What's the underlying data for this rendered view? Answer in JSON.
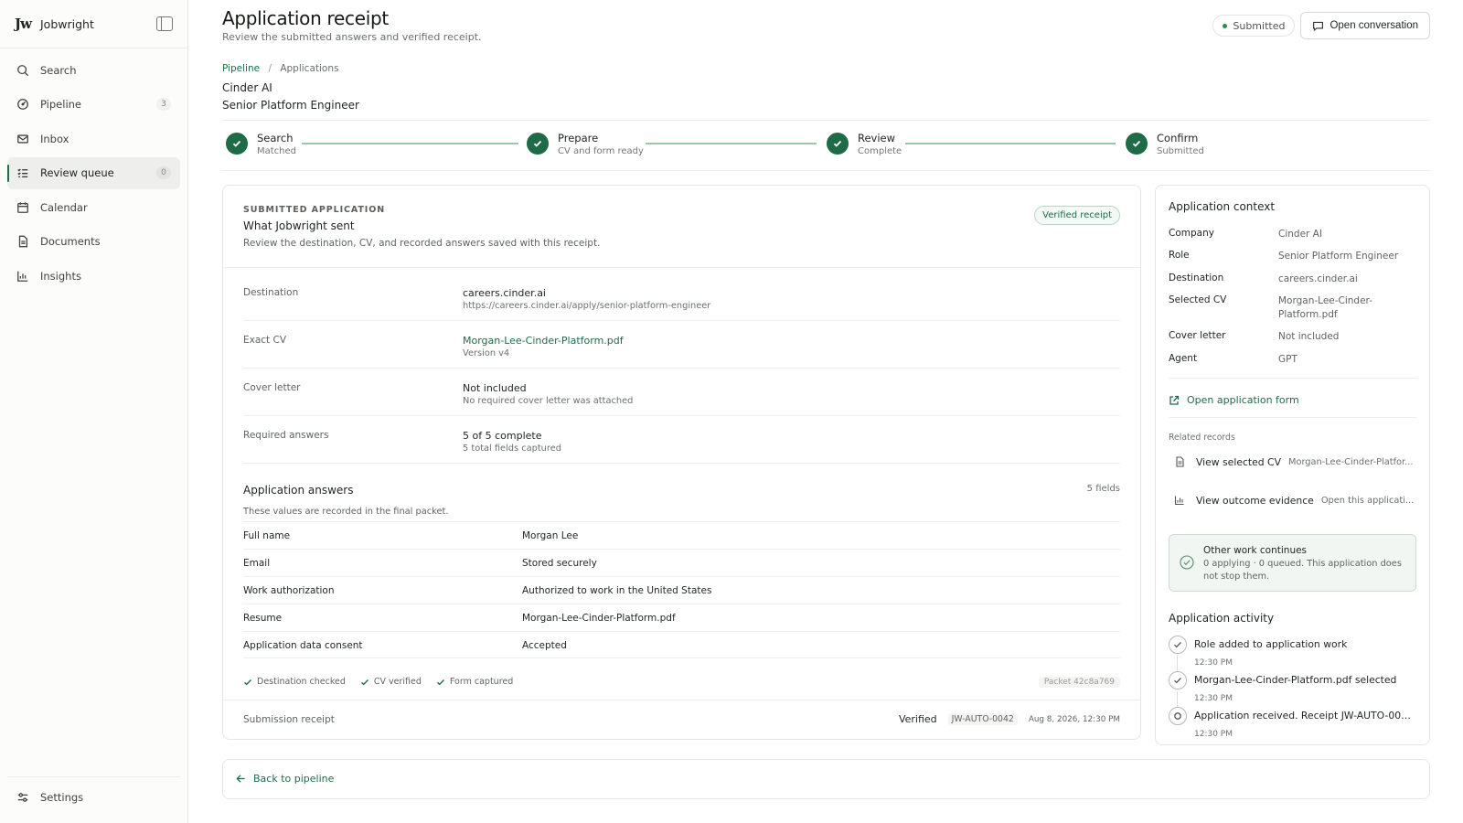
{
  "app": {
    "brand_logo": "Jw",
    "brand_name": "Jobwright"
  },
  "sidebar": {
    "items": [
      {
        "label": "Search",
        "icon": "search-icon",
        "count": ""
      },
      {
        "label": "Pipeline",
        "icon": "pipeline-icon",
        "count": "3"
      },
      {
        "label": "Inbox",
        "icon": "mail-icon",
        "count": ""
      },
      {
        "label": "Review queue",
        "icon": "checklist-icon",
        "count": "0",
        "active": true
      },
      {
        "label": "Calendar",
        "icon": "calendar-icon",
        "count": ""
      },
      {
        "label": "Documents",
        "icon": "document-icon",
        "count": ""
      },
      {
        "label": "Insights",
        "icon": "bar-chart-icon",
        "count": ""
      }
    ],
    "settings_label": "Settings"
  },
  "header": {
    "title": "Application receipt",
    "subtitle": "Review the submitted answers and verified receipt.",
    "status": "Submitted",
    "open_conversation": "Open conversation"
  },
  "breadcrumb": {
    "root": "Pipeline",
    "separator": "/",
    "current": "Applications"
  },
  "job": {
    "company": "Cinder AI",
    "role": "Senior Platform Engineer"
  },
  "steps": [
    {
      "title": "Search",
      "desc": "Matched"
    },
    {
      "title": "Prepare",
      "desc": "CV and form ready"
    },
    {
      "title": "Review",
      "desc": "Complete"
    },
    {
      "title": "Confirm",
      "desc": "Submitted"
    }
  ],
  "submitted": {
    "eyebrow": "SUBMITTED APPLICATION",
    "title": "What Jobwright sent",
    "desc": "Review the destination, CV, and recorded answers saved with this receipt.",
    "badge": "Verified receipt",
    "details": [
      {
        "label": "Destination",
        "value": "careers.cinder.ai",
        "sub": "https://careers.cinder.ai/apply/senior-platform-engineer",
        "link": false
      },
      {
        "label": "Exact CV",
        "value": "Morgan-Lee-Cinder-Platform.pdf",
        "sub": "Version v4",
        "link": true
      },
      {
        "label": "Cover letter",
        "value": "Not included",
        "sub": "No required cover letter was attached",
        "link": false
      },
      {
        "label": "Required answers",
        "value": "5 of 5 complete",
        "sub": "5 total fields captured",
        "link": false
      }
    ],
    "answers_title": "Application answers",
    "answers_count": "5 fields",
    "answers_desc": "These values are recorded in the final packet.",
    "answers": [
      {
        "key": "Full name",
        "value": "Morgan Lee"
      },
      {
        "key": "Email",
        "value": "Stored securely"
      },
      {
        "key": "Work authorization",
        "value": "Authorized to work in the United States"
      },
      {
        "key": "Resume",
        "value": "Morgan-Lee-Cinder-Platform.pdf"
      },
      {
        "key": "Application data consent",
        "value": "Accepted"
      }
    ],
    "checks": [
      "Destination checked",
      "CV verified",
      "Form captured"
    ],
    "packet": "Packet 42c8a769",
    "receipt_label": "Submission receipt",
    "receipt_status": "Verified",
    "receipt_id": "JW-AUTO-0042",
    "receipt_date": "Aug 8, 2026, 12:30 PM"
  },
  "context": {
    "title": "Application context",
    "rows": [
      {
        "key": "Company",
        "value": "Cinder AI"
      },
      {
        "key": "Role",
        "value": "Senior Platform Engineer"
      },
      {
        "key": "Destination",
        "value": "careers.cinder.ai"
      },
      {
        "key": "Selected CV",
        "value": "Morgan-Lee-Cinder-Platform.pdf"
      },
      {
        "key": "Cover letter",
        "value": "Not included"
      },
      {
        "key": "Agent",
        "value": "GPT"
      }
    ],
    "open_form": "Open application form",
    "related_label": "Related records",
    "related": [
      {
        "main": "View selected CV",
        "sub": "Morgan-Lee-Cinder-Platfor...",
        "icon": "document-icon"
      },
      {
        "main": "View outcome evidence",
        "sub": "Open this applicati...",
        "icon": "bar-chart-icon"
      }
    ],
    "other_work_title": "Other work continues",
    "other_work_desc": "0 applying · 0 queued. This application does not stop them.",
    "activity_title": "Application activity",
    "activity": [
      {
        "text": "Role added to application work",
        "time": "12:30 PM",
        "done": true
      },
      {
        "text": "Morgan-Lee-Cinder-Platform.pdf selected",
        "time": "12:30 PM",
        "done": true
      },
      {
        "text": "Application received. Receipt JW-AUTO-0042...",
        "time": "12:30 PM",
        "done": false
      }
    ]
  },
  "back": {
    "label": "Back to pipeline"
  },
  "colors": {
    "accent": "#1f6b47",
    "step_line": "#9fc4ad",
    "badge_bg": "#f3f9f5"
  }
}
